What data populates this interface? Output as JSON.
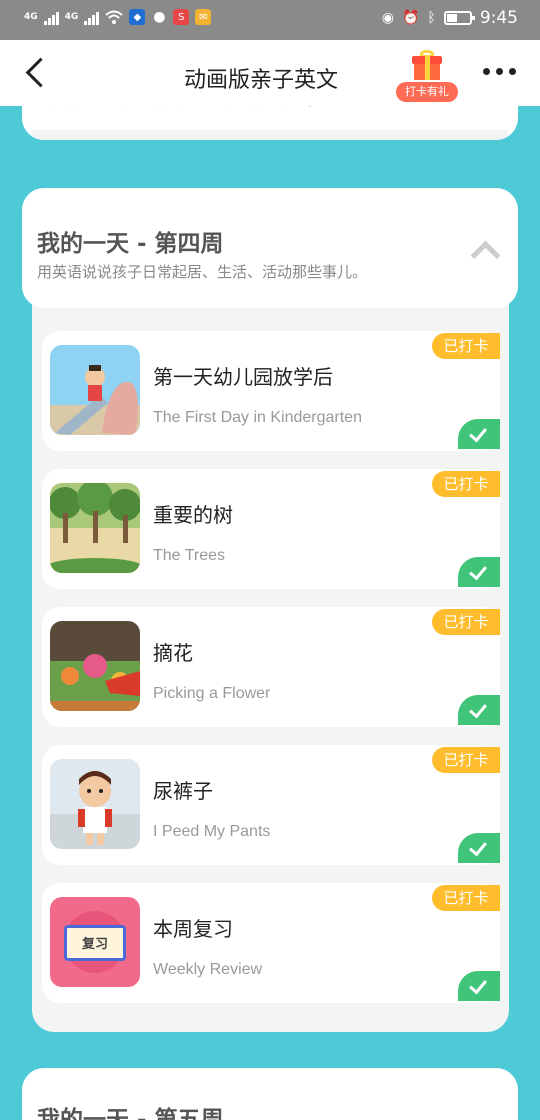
{
  "status_bar": {
    "network1": "4G",
    "network2": "4G",
    "app_icon_3": "S",
    "time": "9:45",
    "battery_level": 0.45
  },
  "header": {
    "title": "动画版亲子英文",
    "gift_label": "打卡有礼"
  },
  "prev_card": {
    "text": "用英语说说孩子日常起居、生活、活动那些事儿。"
  },
  "week": {
    "title": "我的一天 - 第四周",
    "subtitle": "用英语说说孩子日常起居、生活、活动那些事儿。",
    "lessons": [
      {
        "title": "第一天幼儿园放学后",
        "subtitle": "The First Day in Kindergarten",
        "badge": "已打卡",
        "thumb": "playground"
      },
      {
        "title": "重要的树",
        "subtitle": "The Trees",
        "badge": "已打卡",
        "thumb": "forest"
      },
      {
        "title": "摘花",
        "subtitle": "Picking a Flower",
        "badge": "已打卡",
        "thumb": "flower"
      },
      {
        "title": "尿裤子",
        "subtitle": "I Peed My Pants",
        "badge": "已打卡",
        "thumb": "boy"
      },
      {
        "title": "本周复习",
        "subtitle": "Weekly Review",
        "badge": "已打卡",
        "thumb": "review",
        "thumb_text": "复习"
      }
    ]
  },
  "next_week": {
    "title": "我的一天 - 第五周"
  }
}
